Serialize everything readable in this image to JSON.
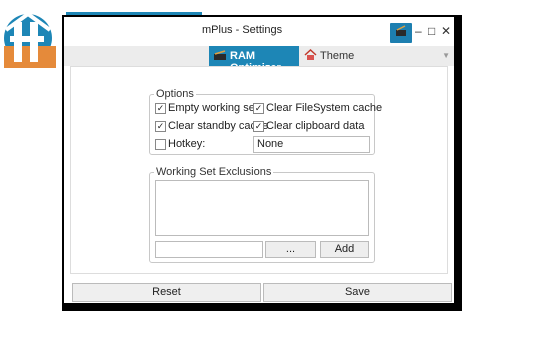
{
  "window": {
    "title": "mPlus - Settings",
    "controls": {
      "minimize": "–",
      "maximize": "□",
      "close": "✕"
    }
  },
  "tabs": [
    {
      "label": "RAM Optimizer",
      "active": true,
      "icon": "ram-icon"
    },
    {
      "label": "Theme",
      "active": false,
      "icon": "house-icon"
    }
  ],
  "options": {
    "legend": "Options",
    "empty_working_sets": {
      "label": "Empty working sets",
      "checked": true
    },
    "clear_filesystem_cache": {
      "label": "Clear FileSystem cache",
      "checked": true
    },
    "clear_standby_cache": {
      "label": "Clear standby cache",
      "checked": true
    },
    "clear_clipboard_data": {
      "label": "Clear clipboard data",
      "checked": true
    },
    "hotkey": {
      "label": "Hotkey:",
      "checked": false,
      "value": "None"
    }
  },
  "exclusions": {
    "legend": "Working Set Exclusions",
    "items": [],
    "path_value": "",
    "browse_label": "...",
    "add_label": "Add"
  },
  "footer": {
    "reset_label": "Reset",
    "save_label": "Save"
  },
  "colors": {
    "accent": "#1d86b6",
    "logo_brown": "#756a4e",
    "logo_orange": "#e58a3a",
    "window_border": "#000000"
  }
}
